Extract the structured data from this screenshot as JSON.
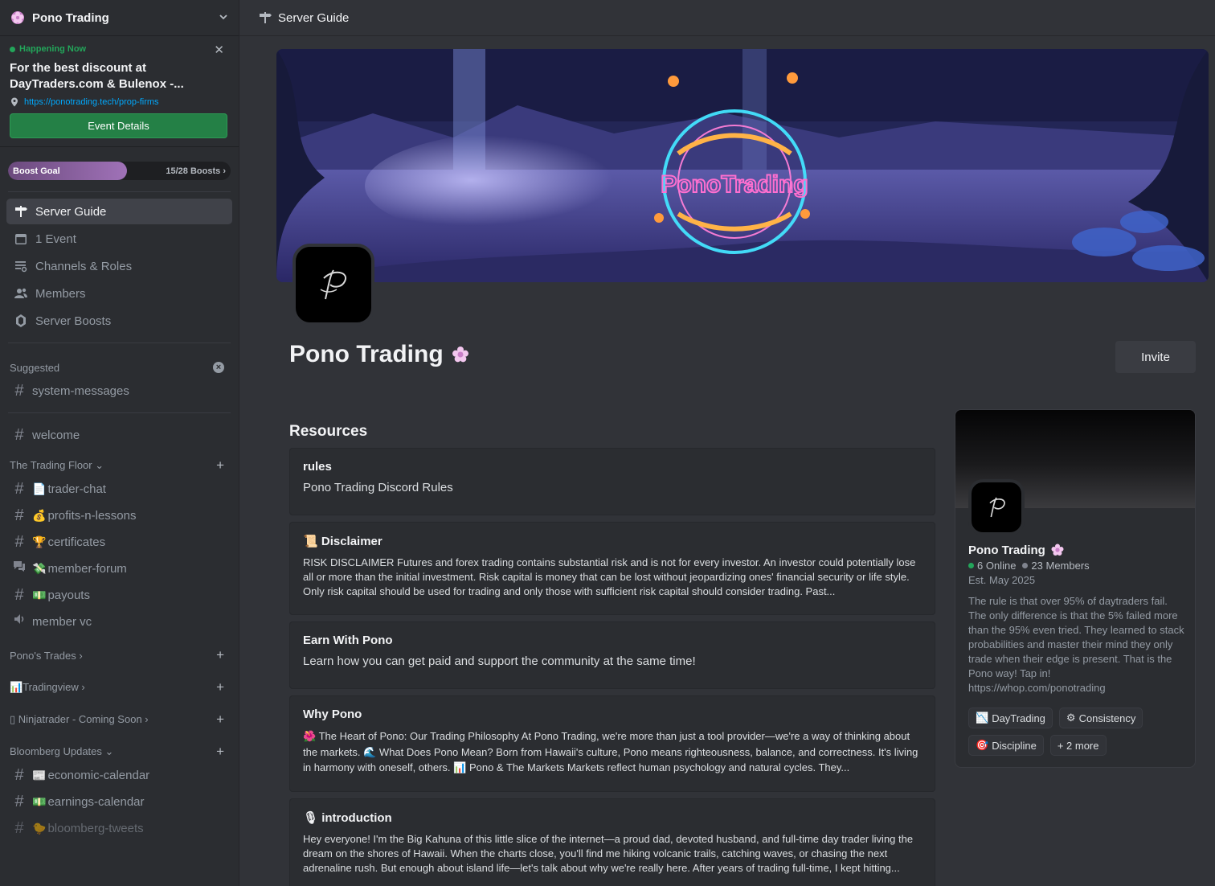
{
  "server": {
    "name": "Pono Trading"
  },
  "event": {
    "status": "Happening Now",
    "title": "For the best discount at DayTraders.com & Bulenox -...",
    "location": "https://ponotrading.tech/prop-firms",
    "button": "Event Details"
  },
  "boost": {
    "label": "Boost Goal",
    "count": "15/28 Boosts",
    "progress": 0.536
  },
  "nav": [
    {
      "label": "Server Guide",
      "icon": "signpost-icon"
    },
    {
      "label": "1 Event",
      "icon": "calendar-icon"
    },
    {
      "label": "Channels & Roles",
      "icon": "channels-roles-icon"
    },
    {
      "label": "Members",
      "icon": "members-icon"
    },
    {
      "label": "Server Boosts",
      "icon": "boost-gem-icon"
    }
  ],
  "suggested": {
    "label": "Suggested",
    "channel": "system-messages"
  },
  "welcome": "welcome",
  "categories": {
    "trading_floor": "The Trading Floor",
    "ponos_trades": "Pono's Trades",
    "tradingview": "Tradingview",
    "ninjatrader": "Ninjatrader - Coming Soon",
    "bloomberg": "Bloomberg Updates"
  },
  "channels": {
    "trader_chat": "trader-chat",
    "profits": "profits-n-lessons",
    "certificates": "certificates",
    "member_forum": "member-forum",
    "payouts": "payouts",
    "member_vc": "member vc",
    "economic_calendar": "economic-calendar",
    "earnings_calendar": "earnings-calendar",
    "bloomberg_tweets": "bloomberg-tweets"
  },
  "topbar": {
    "title": "Server Guide"
  },
  "main": {
    "server_name": "Pono Trading",
    "invite": "Invite",
    "resources_title": "Resources",
    "banner_text": "PonoTrading"
  },
  "resources": [
    {
      "title": "rules",
      "desc": "Pono Trading Discord Rules"
    },
    {
      "title": "Disclaimer",
      "desc": "RISK DISCLAIMER Futures and forex trading contains substantial risk and is not for every investor. An investor could potentially lose all or more than the initial investment. Risk capital is money that can be lost without jeopardizing ones' financial security or life style. Only risk capital should be used for trading and only those with sufficient risk capital should consider trading. Past..."
    },
    {
      "title": "Earn With Pono",
      "desc": "Learn how you can get paid and support the community at the same time!"
    },
    {
      "title": "Why Pono",
      "desc": "The Heart of Pono: Our Trading Philosophy At Pono Trading, we're more than just a tool provider—we're a way of thinking about the markets. 🌊 What Does Pono Mean? Born from Hawaii's culture, Pono means righteousness, balance, and correctness. It's living in harmony with oneself, others. 📊 Pono & The Markets Markets reflect human psychology and natural cycles. They..."
    },
    {
      "title": "introduction",
      "desc": "Hey everyone! I'm the Big Kahuna of this little slice of the internet—a proud dad, devoted husband, and full-time day trader living the dream on the shores of Hawaii. When the charts close, you'll find me hiking volcanic trails, catching waves, or chasing the next adrenaline rush. But enough about island life—let's talk about why we're really here. After years of trading full-time, I kept hitting..."
    }
  ],
  "info_card": {
    "name": "Pono Trading",
    "online": "6 Online",
    "members": "23 Members",
    "established": "Est. May 2025",
    "description": "The rule is that over 95% of daytraders fail. The only difference is that the 5% failed more than the 95% even tried. They learned to stack probabilities and master their mind they only trade when their edge is present. That is the Pono way! Tap in! https://whop.com/ponotrading",
    "tags": [
      {
        "emoji": "📉",
        "label": "DayTrading"
      },
      {
        "emoji": "⚙",
        "label": "Consistency"
      },
      {
        "emoji": "🎯",
        "label": "Discipline"
      },
      {
        "emoji": "",
        "label": "+ 2 more"
      }
    ]
  },
  "colors": {
    "sidebar": "#2b2d31",
    "main": "#313338",
    "green": "#248046",
    "online": "#23a55a",
    "link": "#00a8fc",
    "boost_fill": "#a072b8"
  }
}
